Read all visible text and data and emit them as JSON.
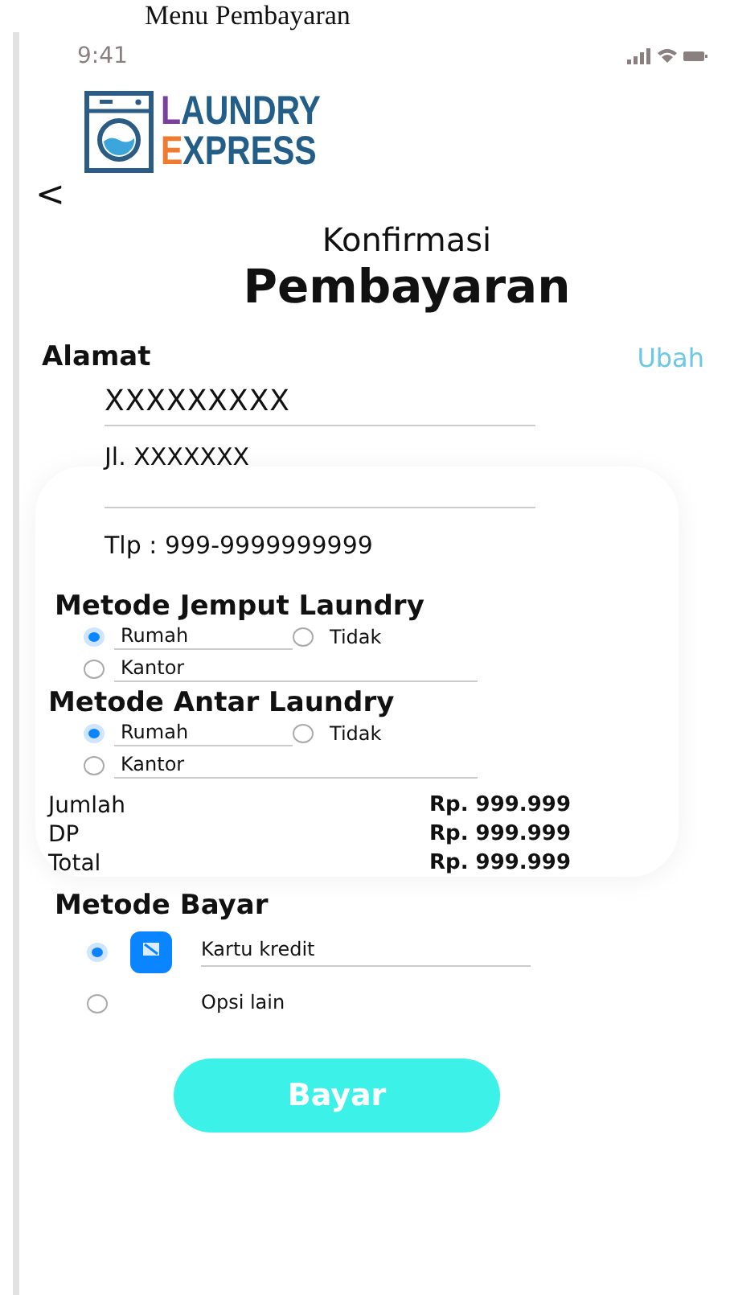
{
  "caption": "Menu Pembayaran",
  "status_bar": {
    "time": "9:41"
  },
  "logo": {
    "line_1": "LAUNDRY",
    "line_2": "EXPRESS"
  },
  "back": "<",
  "title": {
    "line_1": "Konfirmasi",
    "line_2": "Pembayaran"
  },
  "address": {
    "heading": "Alamat",
    "action": "Ubah",
    "name": "XXXXXXXXX",
    "street": "Jl. XXXXXXX",
    "phone": "Tlp : 999-9999999999"
  },
  "pickup": {
    "heading": "Metode Jemput Laundry",
    "options": [
      {
        "label": "Rumah",
        "selected": true
      },
      {
        "label": "Tidak",
        "selected": false
      },
      {
        "label": "Kantor",
        "selected": false
      }
    ]
  },
  "delivery": {
    "heading": "Metode Antar Laundry",
    "options": [
      {
        "label": "Rumah",
        "selected": true
      },
      {
        "label": "Tidak",
        "selected": false
      },
      {
        "label": "Kantor",
        "selected": false
      }
    ]
  },
  "summary": [
    {
      "label": "Jumlah",
      "value": "Rp. 999.999"
    },
    {
      "label": "DP",
      "value": "Rp. 999.999"
    },
    {
      "label": "Total",
      "value": "Rp. 999.999"
    }
  ],
  "payment": {
    "heading": "Metode Bayar",
    "options": [
      {
        "label": "Kartu kredit",
        "selected": true,
        "kind": "card"
      },
      {
        "label": "Opsi lain",
        "selected": false,
        "kind": "plain"
      }
    ]
  },
  "button": "Bayar"
}
